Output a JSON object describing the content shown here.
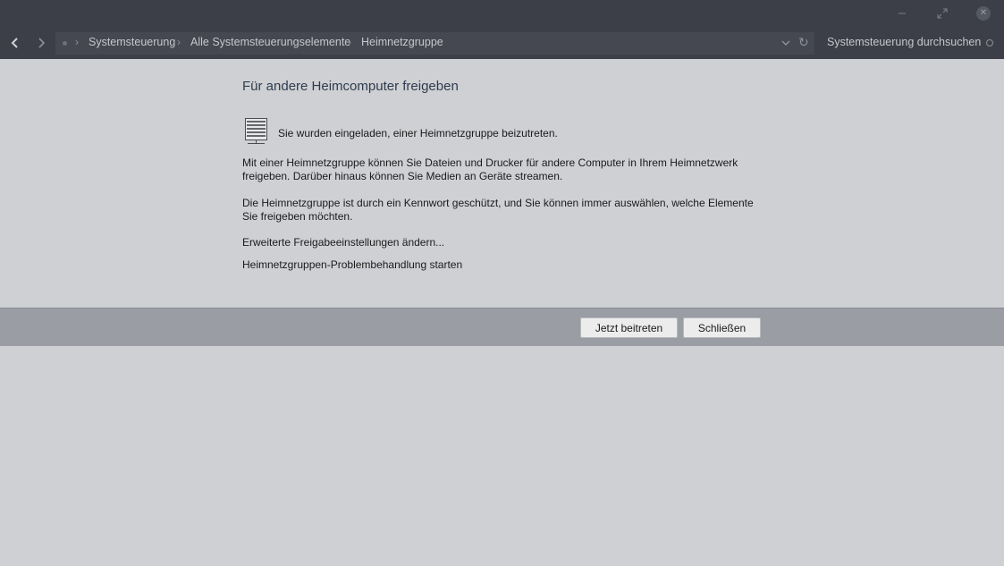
{
  "window": {
    "minimize_icon": "minimize-icon",
    "restore_icon": "restore-icon",
    "close_icon": "close-icon"
  },
  "navigation": {
    "breadcrumbs": [
      {
        "label": "Systemsteuerung"
      },
      {
        "label": "Alle Systemsteuerungselemente"
      },
      {
        "label": "Heimnetzgruppe"
      }
    ],
    "search_placeholder": "Systemsteuerung durchsuchen"
  },
  "main": {
    "title": "Für andere Heimcomputer freigeben",
    "invite_text": "Sie wurden eingeladen, einer Heimnetzgruppe beizutreten.",
    "paragraph_1": "Mit einer Heimnetzgruppe können Sie Dateien und Drucker für andere Computer in Ihrem Heimnetzwerk freigeben. Darüber hinaus können Sie Medien an Geräte streamen.",
    "paragraph_2": "Die Heimnetzgruppe ist durch ein Kennwort geschützt, und Sie können immer auswählen, welche Elemente Sie freigeben möchten.",
    "link_advanced": "Erweiterte Freigabeeinstellungen ändern...",
    "link_troubleshoot": "Heimnetzgruppen-Problembehandlung starten"
  },
  "footer": {
    "join_button": "Jetzt beitreten",
    "close_button": "Schließen"
  },
  "colors": {
    "titlebar": "#3c3f47",
    "content_bg": "#cfd0d4",
    "footer_bg": "#9a9da4",
    "title_text": "#2e3c4e"
  }
}
